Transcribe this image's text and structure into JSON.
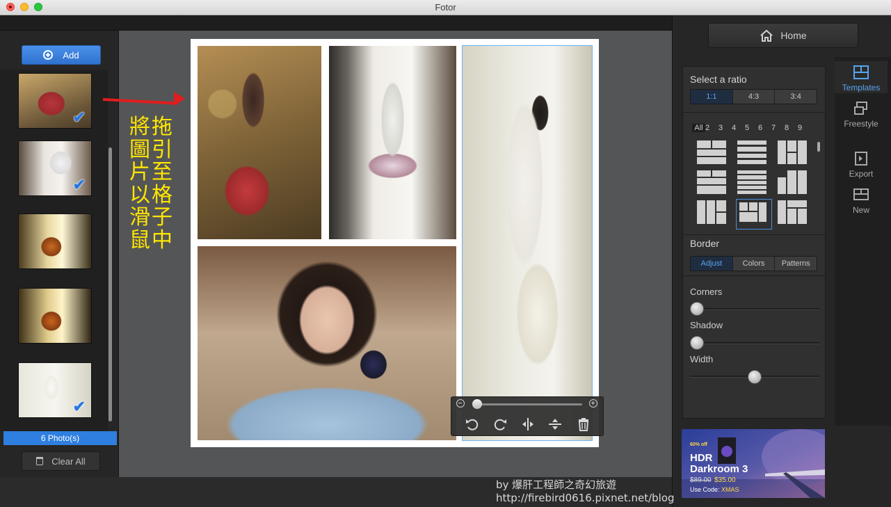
{
  "window": {
    "title": "Fotor"
  },
  "left_panel": {
    "add_label": "Add",
    "photo_count": "6 Photo(s)",
    "clear_label": "Clear All"
  },
  "annotation": {
    "col1": "拖\n引\n至\n格\n子\n中",
    "col2": "將\n圖\n片\n以\n滑\n鼠"
  },
  "right_panel": {
    "home_label": "Home",
    "ratio_title": "Select a ratio",
    "ratios": [
      "1:1",
      "4:3",
      "3:4"
    ],
    "active_ratio": "1:1",
    "template_counts": [
      "All",
      "2",
      "3",
      "4",
      "5",
      "6",
      "7",
      "8",
      "9"
    ],
    "border_title": "Border",
    "border_tabs": [
      "Adjust",
      "Colors",
      "Patterns"
    ],
    "corners_label": "Corners",
    "shadow_label": "Shadow",
    "width_label": "Width",
    "corners_value": 0,
    "shadow_value": 0,
    "width_value": 0.5
  },
  "side_nav": {
    "templates": "Templates",
    "freestyle": "Freestyle",
    "export": "Export",
    "new": "New"
  },
  "promo": {
    "badge": "60% off",
    "title1": "HDR",
    "title2": "Darkroom 3",
    "old_price": "$89.00",
    "new_price": "$35.00",
    "code_label": "Use Code:",
    "code": "XMAS"
  },
  "footer": {
    "line1": "by 爆肝工程師之奇幻旅遊",
    "line2": "http://firebird0616.pixnet.net/blog"
  }
}
